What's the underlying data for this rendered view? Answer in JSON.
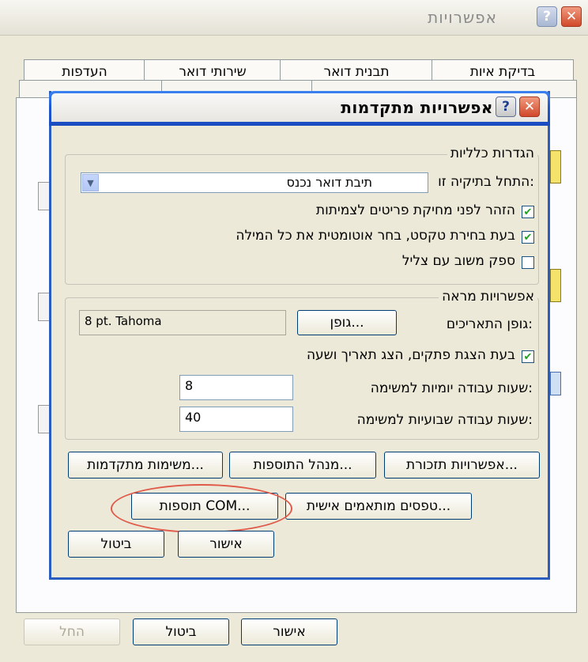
{
  "outer": {
    "title": "אפשרויות",
    "help_label": "?",
    "close_label": "✕",
    "tabs": [
      "העדפות",
      "שירותי דואר",
      "תבנית דואר",
      "בדיקת איות"
    ],
    "buttons": {
      "ok": "אישור",
      "cancel": "ביטול",
      "apply": "החל"
    }
  },
  "dialog": {
    "title": "אפשרויות מתקדמות",
    "help_label": "?",
    "close_label": "✕",
    "general": {
      "legend": "הגדרות כלליות",
      "startup_label": "התחל בתיקיה זו:",
      "startup_value": "תיבת דואר נכנס",
      "checkboxes": [
        {
          "label": "הזהר לפני מחיקת פריטים לצמיתות",
          "checked": true
        },
        {
          "label": "בעת בחירת טקסט, בחר אוטומטית את כל המילה",
          "checked": true
        },
        {
          "label": "ספק משוב עם צליל",
          "checked": false
        }
      ]
    },
    "appearance": {
      "legend": "אפשרויות מראה",
      "date_font_label": "גופן התאריכים:",
      "font_button": "גופן...",
      "font_value": "8 pt. Tahoma",
      "show_time_label": "בעת הצגת פתקים, הצג תאריך ושעה",
      "show_time_checked": true,
      "daily_hours_label": "שעות עבודה יומיות למשימה:",
      "daily_hours_value": "8",
      "weekly_hours_label": "שעות עבודה שבועיות למשימה:",
      "weekly_hours_value": "40"
    },
    "buttons": {
      "reminder_options": "אפשרויות תזכורת...",
      "addin_manager": "מנהל התוספות...",
      "advanced_tasks": "משימות מתקדמות...",
      "custom_forms": "טפסים מותאמים אישית...",
      "com_addins": "תוספות COM...",
      "ok": "אישור",
      "cancel": "ביטול"
    }
  }
}
